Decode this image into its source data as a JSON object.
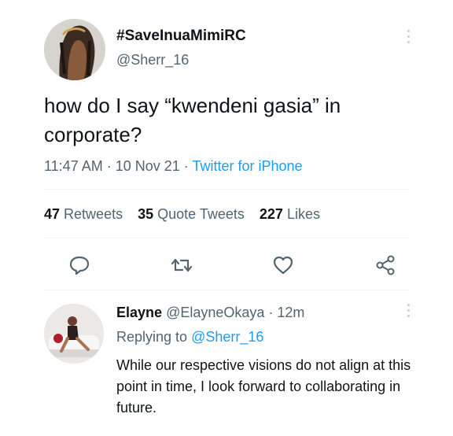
{
  "tweet": {
    "display_name": "#SaveInuaMimiRC",
    "handle": "@Sherr_16",
    "text": "how do I say “kwendeni gasia” in corporate?",
    "time": "11:47 AM",
    "sep1": " · ",
    "date": "10 Nov 21",
    "sep2": " · ",
    "source": "Twitter for iPhone",
    "more_icon": "more-dots-icon"
  },
  "stats": {
    "retweets_count": "47",
    "retweets_label": "Retweets",
    "quotes_count": "35",
    "quotes_label": "Quote Tweets",
    "likes_count": "227",
    "likes_label": "Likes"
  },
  "actions": {
    "reply_icon": "reply-icon",
    "retweet_icon": "retweet-icon",
    "like_icon": "heart-icon",
    "share_icon": "share-icon",
    "icon_color": "#536471"
  },
  "reply": {
    "name": "Elayne",
    "handle": "@ElayneOkaya",
    "sep": " · ",
    "age": "12m",
    "replying_prefix": "Replying to ",
    "replying_to": "@Sherr_16",
    "text": "While our respective visions do not align at this point in time, I look forward to collaborating in future."
  },
  "colors": {
    "text": "#0f1419",
    "secondary": "#536471",
    "link": "#1d9bf0",
    "divider": "#eff3f4"
  }
}
